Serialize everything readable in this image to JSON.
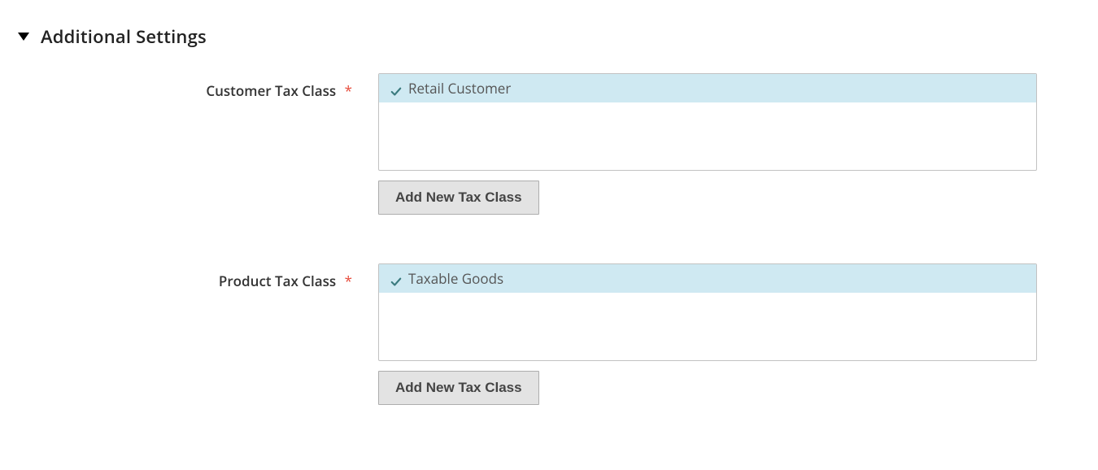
{
  "section": {
    "title": "Additional Settings"
  },
  "customer_tax_class": {
    "label": "Customer Tax Class",
    "required_star": "*",
    "options": [
      {
        "label": "Retail Customer",
        "selected": true
      }
    ],
    "add_button": "Add New Tax Class"
  },
  "product_tax_class": {
    "label": "Product Tax Class",
    "required_star": "*",
    "options": [
      {
        "label": "Taxable Goods",
        "selected": true
      }
    ],
    "add_button": "Add New Tax Class"
  }
}
